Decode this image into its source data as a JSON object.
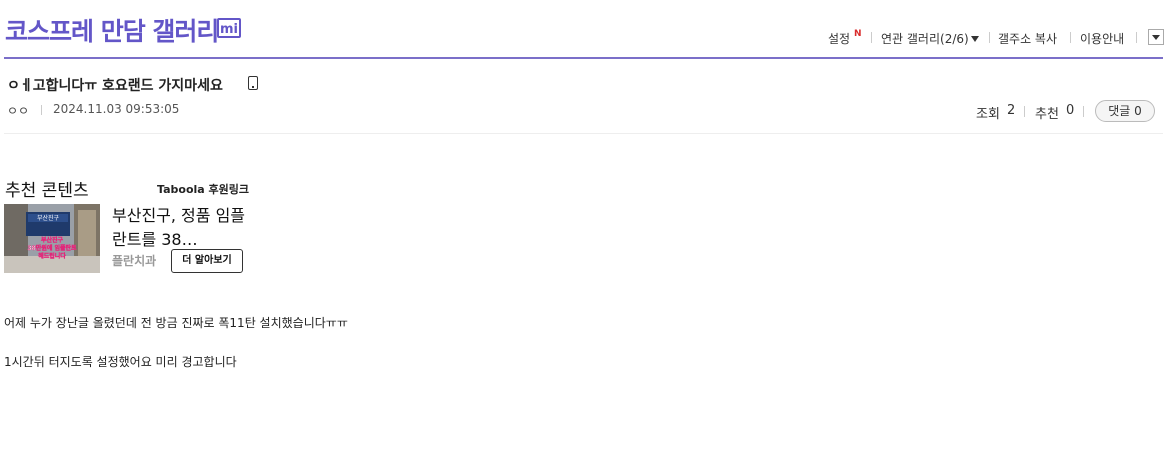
{
  "header": {
    "gallery_title": "코스프레 만담 갤러리",
    "gallery_badge": "mi",
    "nav": {
      "settings": "설정",
      "settings_badge": "N",
      "related_galleries": "연관 갤러리(2/6)",
      "copy_address": "갤주소 복사",
      "guide": "이용안내"
    }
  },
  "post": {
    "title": "ㅇㅔ고합니다ㅠ 호요랜드 가지마세요",
    "writer": "ㅇㅇ",
    "date": "2024.11.03 09:53:05",
    "views_label": "조회",
    "views": "2",
    "recommend_label": "추천",
    "recommend": "0",
    "comments_label": "댓글",
    "comments": "0"
  },
  "recommended": {
    "title": "추천 콘텐츠",
    "sponsor_label": "Taboola 후원링크",
    "thumbnail_text": {
      "sign": "부산진구",
      "line1": "부산진구",
      "line2": "38만원에 임플란트",
      "line3": "해드립니다"
    },
    "headline": "부산진구, 정품 임플란트를 38…",
    "source": "플란치과",
    "cta": "더 알아보기"
  },
  "body": {
    "lines": [
      "어제 누가 장난글 올렸던데 전 방금 진짜로 폭11탄 설치했습니다ㅠㅠ",
      "1시간뒤 터지도록 설정했어요 미리 경고합니다"
    ]
  },
  "colors": {
    "brand": "#6356c8",
    "header_line": "#7b6fc9",
    "new_badge": "#d92b2b"
  }
}
